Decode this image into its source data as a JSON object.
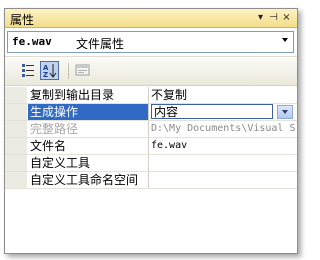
{
  "window": {
    "title": "属性",
    "buttons": {
      "dropdown_icon": "▾",
      "pin_icon": "⊣",
      "close_icon": "×"
    }
  },
  "object_selector": {
    "name": "fe.wav",
    "type_label": "文件属性"
  },
  "toolbar": {
    "icons": [
      "categorized-icon",
      "alphabetical-icon",
      "property-pages-icon"
    ]
  },
  "properties": [
    {
      "label": "复制到输出目录",
      "value": "不复制"
    },
    {
      "label": "生成操作",
      "value": "内容",
      "selected": true
    },
    {
      "label": "完整路径",
      "value": "D:\\My Documents\\Visual S",
      "disabled": true
    },
    {
      "label": "文件名",
      "value": "fe.wav"
    },
    {
      "label": "自定义工具",
      "value": ""
    },
    {
      "label": "自定义工具命名空间",
      "value": ""
    }
  ],
  "colors": {
    "selection": "#316ac5",
    "titlebar": "#f3dd8a"
  }
}
